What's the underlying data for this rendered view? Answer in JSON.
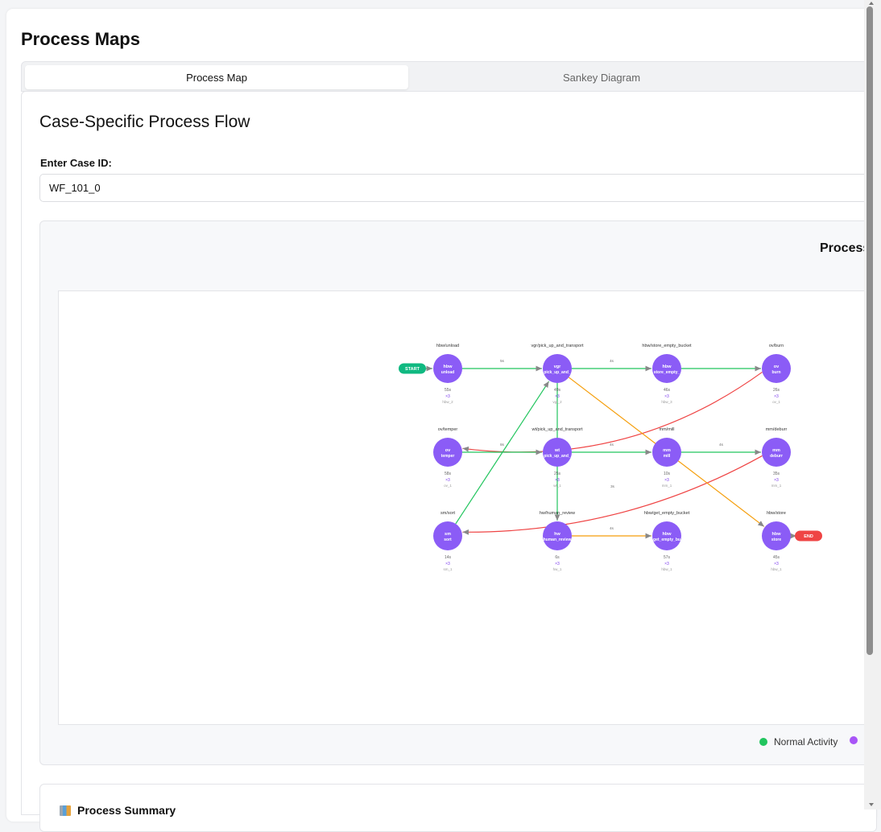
{
  "page": {
    "title": "Process Maps"
  },
  "tabs": [
    {
      "label": "Process Map",
      "active": true
    },
    {
      "label": "Sankey Diagram",
      "active": false
    }
  ],
  "section": {
    "title": "Case-Specific Process Flow",
    "case_label": "Enter Case ID:",
    "case_value": "WF_101_0"
  },
  "map": {
    "title": "Process",
    "start_label": "START",
    "end_label": "END",
    "nodes": [
      {
        "id": "hbw_unload",
        "activity": "hbw/unload",
        "line1": "hbw",
        "line2": "unload",
        "duration": "55s",
        "count": "×3",
        "resource": "hbw_2"
      },
      {
        "id": "vgr_pick",
        "activity": "vgr/pick_up_and_transport",
        "line1": "vgr",
        "line2": "pick_up_and_",
        "duration": "49s",
        "count": "×3",
        "resource": "vgr_2"
      },
      {
        "id": "hbw_store_empty",
        "activity": "hbw/store_empty_bucket",
        "line1": "hbw",
        "line2": "store_empty_",
        "duration": "46s",
        "count": "×3",
        "resource": "hbw_3"
      },
      {
        "id": "ov_burn",
        "activity": "ov/burn",
        "line1": "ov",
        "line2": "burn",
        "duration": "26s",
        "count": "×3",
        "resource": "ov_1"
      },
      {
        "id": "ov_temper",
        "activity": "ov/temper",
        "line1": "ov",
        "line2": "temper",
        "duration": "58s",
        "count": "×3",
        "resource": "ov_1"
      },
      {
        "id": "wt_pick",
        "activity": "wt/pick_up_and_transport",
        "line1": "wt",
        "line2": "pick_up_and_",
        "duration": "25s",
        "count": "×3",
        "resource": "wt_1"
      },
      {
        "id": "mm_mill",
        "activity": "mm/mill",
        "line1": "mm",
        "line2": "mill",
        "duration": "10s",
        "count": "×3",
        "resource": "mm_1"
      },
      {
        "id": "mm_deburr",
        "activity": "mm/deburr",
        "line1": "mm",
        "line2": "deburr",
        "duration": "35s",
        "count": "×3",
        "resource": "mm_1"
      },
      {
        "id": "sm_sort",
        "activity": "sm/sort",
        "line1": "sm",
        "line2": "sort",
        "duration": "14s",
        "count": "×3",
        "resource": "sm_1"
      },
      {
        "id": "hw_review",
        "activity": "hw/human_review",
        "line1": "hw",
        "line2": "human_review",
        "duration": "6s",
        "count": "×3",
        "resource": "hw_1"
      },
      {
        "id": "hbw_get_empty",
        "activity": "hbw/get_empty_bucket",
        "line1": "hbw",
        "line2": "get_empty_bu",
        "duration": "57s",
        "count": "×3",
        "resource": "hbw_1"
      },
      {
        "id": "hbw_store",
        "activity": "hbw/store",
        "line1": "hbw",
        "line2": "store",
        "duration": "45s",
        "count": "×3",
        "resource": "hbw_1"
      }
    ],
    "edges": [
      {
        "from": "start",
        "to": "hbw_unload",
        "label": "",
        "color": "#22c55e"
      },
      {
        "from": "hbw_unload",
        "to": "vgr_pick",
        "label": "5s",
        "color": "#22c55e"
      },
      {
        "from": "vgr_pick",
        "to": "hbw_store_empty",
        "label": "4s",
        "color": "#22c55e"
      },
      {
        "from": "hbw_store_empty",
        "to": "ov_burn",
        "label": "",
        "color": "#22c55e"
      },
      {
        "from": "ov_burn",
        "to": "ov_temper",
        "label": "",
        "color": "#ef4444"
      },
      {
        "from": "ov_temper",
        "to": "wt_pick",
        "label": "8s",
        "color": "#22c55e"
      },
      {
        "from": "wt_pick",
        "to": "mm_mill",
        "label": "4s",
        "color": "#22c55e"
      },
      {
        "from": "mm_mill",
        "to": "mm_deburr",
        "label": "4s",
        "color": "#22c55e"
      },
      {
        "from": "mm_deburr",
        "to": "sm_sort",
        "label": "3s",
        "color": "#ef4444"
      },
      {
        "from": "sm_sort",
        "to": "vgr_pick",
        "label": "",
        "color": "#22c55e"
      },
      {
        "from": "vgr_pick",
        "to": "hw_review",
        "label": "",
        "color": "#22c55e"
      },
      {
        "from": "hw_review",
        "to": "hbw_get_empty",
        "label": "4s",
        "color": "#f59e0b"
      },
      {
        "from": "vgr_pick",
        "to": "hbw_store",
        "label": "4s",
        "color": "#f59e0b"
      },
      {
        "from": "hbw_store",
        "to": "end",
        "label": "",
        "color": "#ef4444"
      }
    ]
  },
  "legend": [
    {
      "label": "Normal Activity",
      "color": "#22c55e"
    },
    {
      "label": "",
      "color": "#a855f7"
    }
  ],
  "colors": {
    "node_fill": "#8b5cf6",
    "start": "#10b981",
    "end": "#ef4444",
    "edge_green": "#22c55e",
    "edge_red": "#ef4444",
    "edge_orange": "#f59e0b"
  },
  "summary": {
    "title": "Process Summary"
  }
}
